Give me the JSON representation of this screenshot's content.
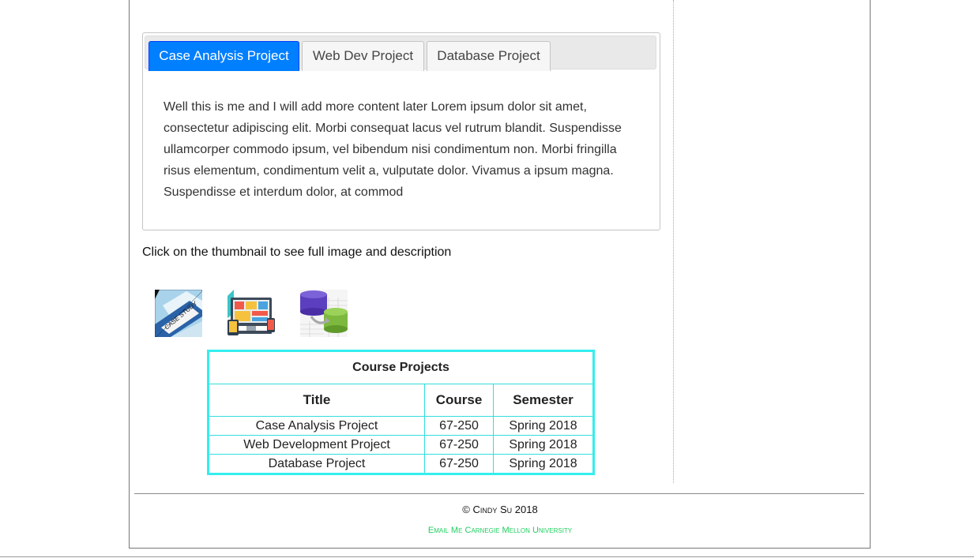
{
  "tabs": [
    {
      "label": "Case Analysis Project",
      "active": true
    },
    {
      "label": "Web Dev Project",
      "active": false
    },
    {
      "label": "Database Project",
      "active": false
    }
  ],
  "tab_content": "Well this is me and I will add more content later Lorem ipsum dolor sit amet, consectetur adipiscing elit. Morbi consequat lacus vel rutrum blandit. Suspendisse ullamcorper commodo ipsum, vel bibendum nisi condimentum non. Morbi fringilla risus elementum, condimentum velit a, vulputate dolor. Vivamus a ipsum magna. Suspendisse et interdum dolor, at commod",
  "instructions": "Click on the thumbnail to see full image and description",
  "thumbnails": [
    {
      "name": "case-study-thumbnail",
      "label": "CASE STUDY"
    },
    {
      "name": "web-dev-thumbnail"
    },
    {
      "name": "database-thumbnail"
    }
  ],
  "table": {
    "caption": "Course Projects",
    "headers": [
      "Title",
      "Course",
      "Semester"
    ],
    "rows": [
      [
        "Case Analysis Project",
        "67-250",
        "Spring 2018"
      ],
      [
        "Web Development Project",
        "67-250",
        "Spring 2018"
      ],
      [
        "Database Project",
        "67-250",
        "Spring 2018"
      ]
    ]
  },
  "footer": {
    "copyright": "© Cindy Su 2018",
    "email_link": "Email Me",
    "university_link": "Carnegie Mellon University"
  },
  "colors": {
    "active_tab": "#007fff",
    "table_border": "#33eeee",
    "footer_link": "#1fcf5f"
  }
}
